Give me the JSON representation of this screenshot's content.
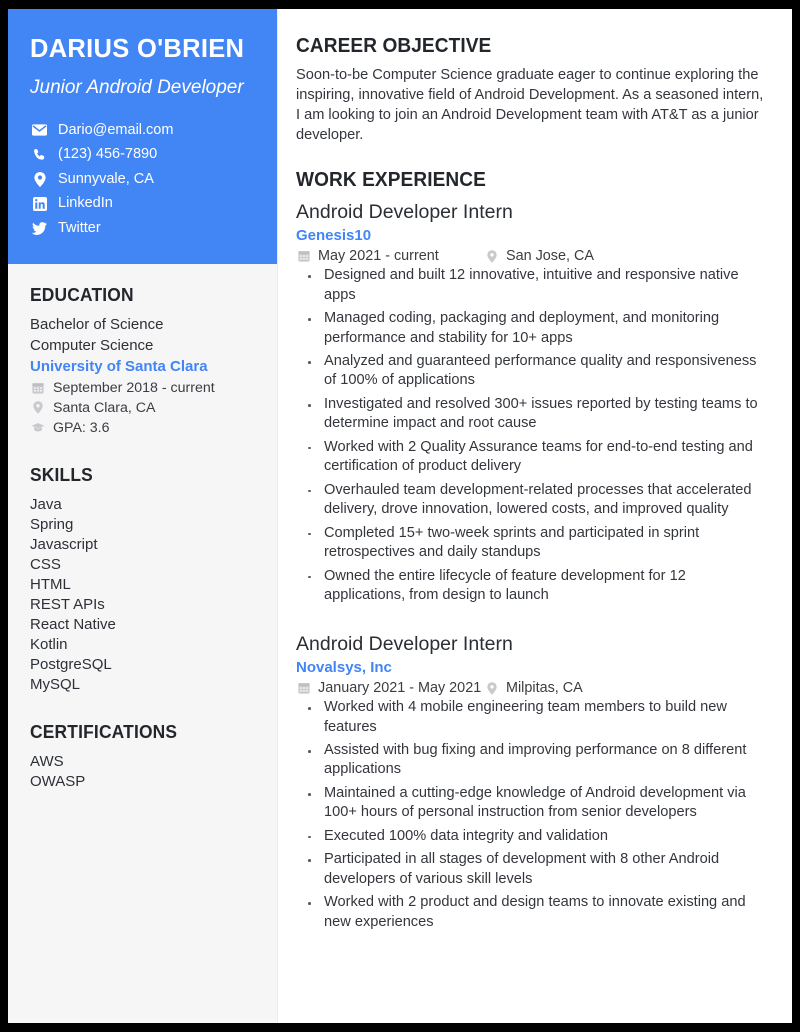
{
  "header": {
    "name": "DARIUS O'BRIEN",
    "title": "Junior Android Developer",
    "accent_color": "#4285f4",
    "contacts": [
      {
        "icon": "envelope-icon",
        "value": "Dario@email.com"
      },
      {
        "icon": "phone-icon",
        "value": "(123) 456-7890"
      },
      {
        "icon": "map-pin-icon",
        "value": "Sunnyvale, CA"
      },
      {
        "icon": "linkedin-icon",
        "value": "LinkedIn"
      },
      {
        "icon": "twitter-icon",
        "value": "Twitter"
      }
    ]
  },
  "education": {
    "heading": "EDUCATION",
    "degree": "Bachelor of Science",
    "field": "Computer Science",
    "school": "University of Santa Clara",
    "dates": "September 2018 - current",
    "location": "Santa Clara, CA",
    "gpa": "GPA: 3.6"
  },
  "skills": {
    "heading": "SKILLS",
    "items": [
      "Java",
      "Spring",
      "Javascript",
      "CSS",
      "HTML",
      "REST APIs",
      "React Native",
      "Kotlin",
      "PostgreSQL",
      "MySQL"
    ]
  },
  "certifications": {
    "heading": "CERTIFICATIONS",
    "items": [
      "AWS",
      "OWASP"
    ]
  },
  "objective": {
    "heading": "CAREER OBJECTIVE",
    "text": "Soon-to-be Computer Science graduate eager to continue exploring the inspiring, innovative field of Android Development. As a seasoned intern, I am looking to join an Android Development team with AT&T as a junior developer."
  },
  "work": {
    "heading": "WORK EXPERIENCE",
    "jobs": [
      {
        "title": "Android Developer Intern",
        "company": "Genesis10",
        "dates": "May 2021 - current",
        "location": "San Jose, CA",
        "bullets": [
          "Designed and built 12 innovative, intuitive and responsive native apps",
          "Managed coding, packaging and deployment, and monitoring performance and stability for 10+ apps",
          "Analyzed and guaranteed performance quality and responsiveness of 100% of applications",
          "Investigated and resolved 300+ issues reported by testing teams to determine impact and root cause",
          "Worked with 2 Quality Assurance teams for end-to-end testing and certification of product delivery",
          "Overhauled team development-related processes that accelerated delivery, drove innovation, lowered costs, and improved quality",
          "Completed 15+ two-week sprints and participated in sprint retrospectives and daily standups",
          "Owned the entire lifecycle of feature development for 12 applications, from design to launch"
        ]
      },
      {
        "title": "Android Developer Intern",
        "company": "Novalsys, Inc",
        "dates": "January 2021 - May 2021",
        "location": "Milpitas, CA",
        "bullets": [
          "Worked with 4 mobile engineering team members to build new features",
          "Assisted with bug fixing and improving performance on 8 different applications",
          "Maintained a cutting-edge knowledge of Android development via 100+ hours of personal instruction from senior developers",
          "Executed 100% data integrity and validation",
          "Participated in all stages of development with 8 other Android developers of various skill levels",
          "Worked with 2 product and design teams to innovate existing and new experiences"
        ]
      }
    ]
  }
}
